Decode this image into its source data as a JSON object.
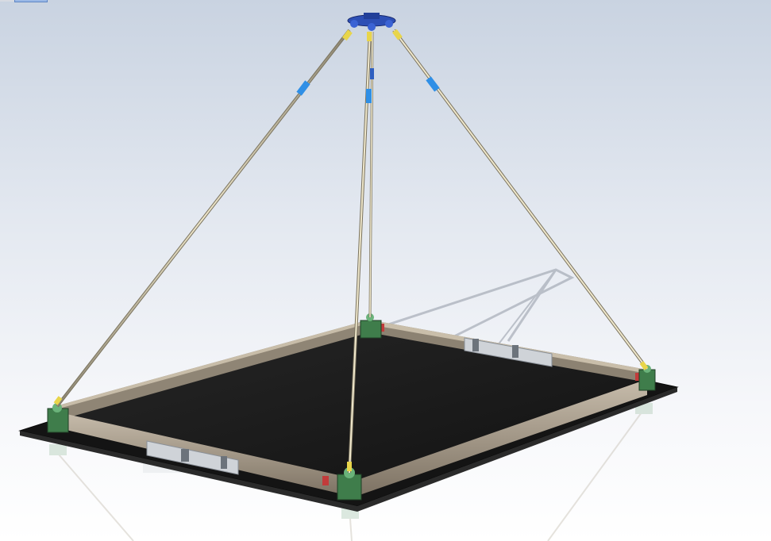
{
  "viewport": {
    "background_top": "#c9d3e1",
    "background_bottom": "#ffffff"
  },
  "model": {
    "tray_surface_color": "#1c1c1c",
    "base_plate_color": "#141414",
    "wall_color": "#a39888",
    "corner_bracket_color": "#3f7d4b",
    "hub_color": "#2d4fb5",
    "sling_rod_color": "#d9cfae",
    "turnbuckle_color": "#2f8fe6",
    "end_fitting_color": "#e8d54a",
    "handle_color": "#cfd3d8"
  },
  "icons": {
    "view_selection": "selection-tab-icon"
  }
}
